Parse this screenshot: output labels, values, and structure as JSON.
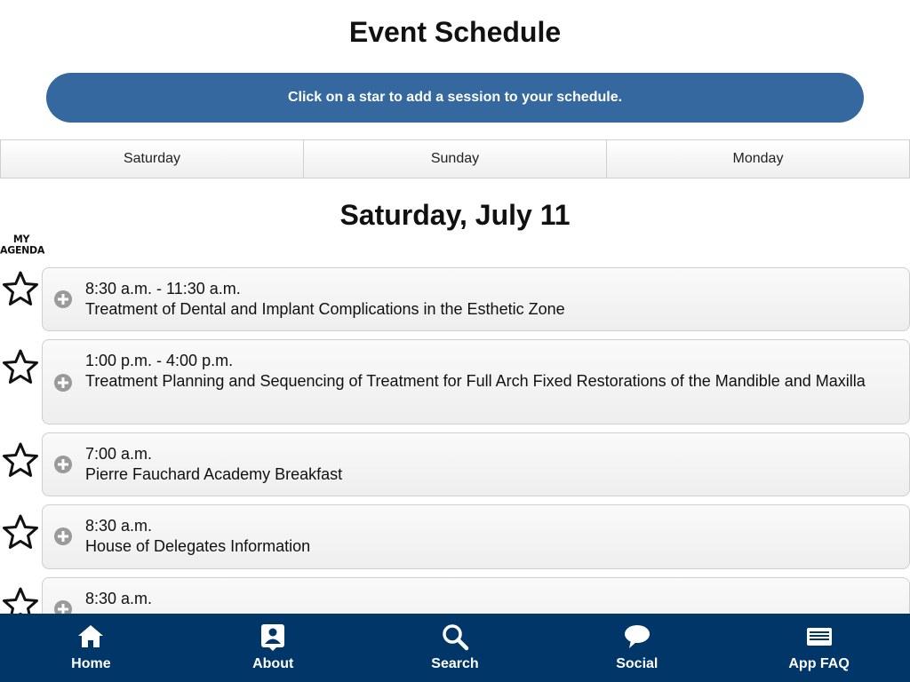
{
  "header": {
    "title": "Event Schedule",
    "banner_text": "Click on a star to add a session to your schedule."
  },
  "day_tabs": [
    {
      "label": "Saturday"
    },
    {
      "label": "Sunday"
    },
    {
      "label": "Monday"
    }
  ],
  "day_heading": "Saturday, July 11",
  "agenda_label": {
    "line1": "MY",
    "line2": "AGENDA"
  },
  "sessions": [
    {
      "time": "8:30 a.m. - 11:30 a.m.",
      "title": "Treatment of Dental and Implant Complications in the Esthetic Zone",
      "starred": false
    },
    {
      "time": "1:00 p.m. - 4:00 p.m.",
      "title": "Treatment Planning and Sequencing of Treatment for Full Arch Fixed Restorations of the Mandible and Maxilla",
      "starred": false
    },
    {
      "time": "7:00 a.m.",
      "title": "Pierre Fauchard Academy Breakfast",
      "starred": false
    },
    {
      "time": "8:30 a.m.",
      "title": "House of Delegates Information",
      "starred": false
    },
    {
      "time": "8:30 a.m.",
      "title": "",
      "starred": false
    }
  ],
  "bottom_nav": [
    {
      "label": "Home",
      "icon": "home-icon"
    },
    {
      "label": "About",
      "icon": "about-icon"
    },
    {
      "label": "Search",
      "icon": "search-icon"
    },
    {
      "label": "Social",
      "icon": "chat-bubble-icon"
    },
    {
      "label": "App FAQ",
      "icon": "faq-icon"
    }
  ],
  "colors": {
    "banner": "#35689e",
    "nav_background": "#003768",
    "expand_icon": "#9a9a9a"
  }
}
